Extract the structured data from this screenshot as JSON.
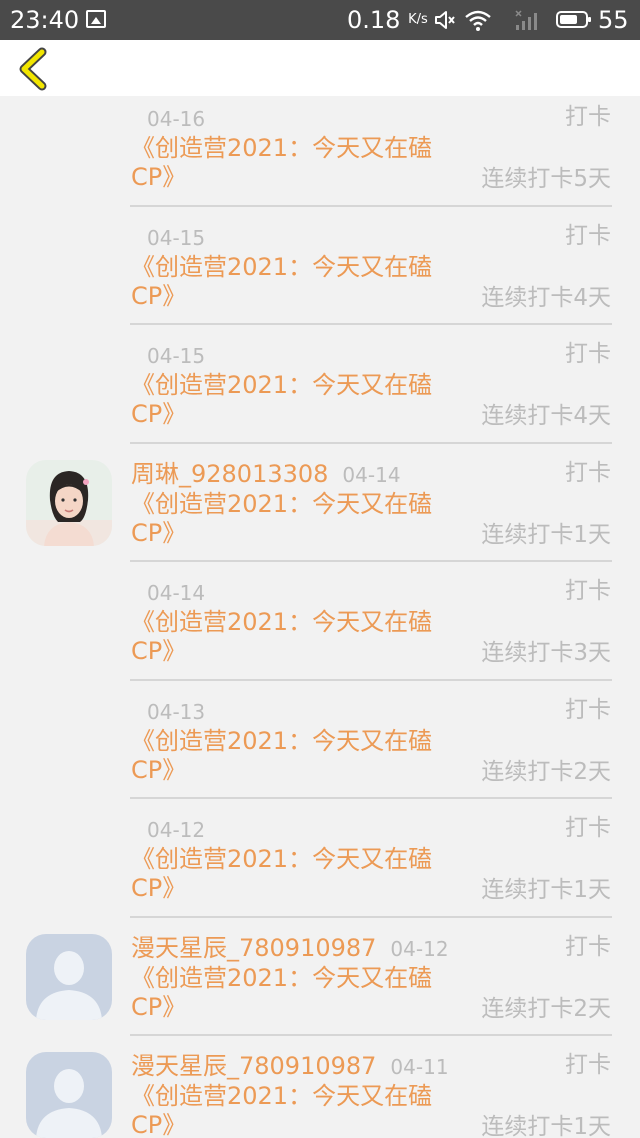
{
  "status_bar": {
    "time": "23:40",
    "net_speed": "0.18",
    "net_unit": "K/s",
    "battery": "55",
    "icons": [
      "image-icon",
      "mute-icon",
      "wifi-icon",
      "signal-icon",
      "battery-icon"
    ]
  },
  "header": {
    "back_icon": "chevron-left-icon",
    "accent": "#f2e600"
  },
  "colors": {
    "title": "#ec9a55",
    "meta": "#bcbcbc",
    "divider": "#d6d6d6"
  },
  "feed": [
    {
      "user": "",
      "avatar": "",
      "date": "04-16",
      "type": "打卡",
      "title": "《创造营2021：今天又在磕CP》",
      "streak": "连续打卡5天"
    },
    {
      "user": "",
      "avatar": "",
      "date": "04-15",
      "type": "打卡",
      "title": "《创造营2021：今天又在磕CP》",
      "streak": "连续打卡4天"
    },
    {
      "user": "",
      "avatar": "",
      "date": "04-15",
      "type": "打卡",
      "title": "《创造营2021：今天又在磕CP》",
      "streak": "连续打卡4天"
    },
    {
      "user": "周琳_928013308",
      "avatar": "photo",
      "date": "04-14",
      "type": "打卡",
      "title": "《创造营2021：今天又在磕CP》",
      "streak": "连续打卡1天"
    },
    {
      "user": "",
      "avatar": "",
      "date": "04-14",
      "type": "打卡",
      "title": "《创造营2021：今天又在磕CP》",
      "streak": "连续打卡3天"
    },
    {
      "user": "",
      "avatar": "",
      "date": "04-13",
      "type": "打卡",
      "title": "《创造营2021：今天又在磕CP》",
      "streak": "连续打卡2天"
    },
    {
      "user": "",
      "avatar": "",
      "date": "04-12",
      "type": "打卡",
      "title": "《创造营2021：今天又在磕CP》",
      "streak": "连续打卡1天"
    },
    {
      "user": "漫天星辰_780910987",
      "avatar": "default",
      "date": "04-12",
      "type": "打卡",
      "title": "《创造营2021：今天又在磕CP》",
      "streak": "连续打卡2天"
    },
    {
      "user": "漫天星辰_780910987",
      "avatar": "default",
      "date": "04-11",
      "type": "打卡",
      "title": "《创造营2021：今天又在磕CP》",
      "streak": "连续打卡1天"
    }
  ]
}
